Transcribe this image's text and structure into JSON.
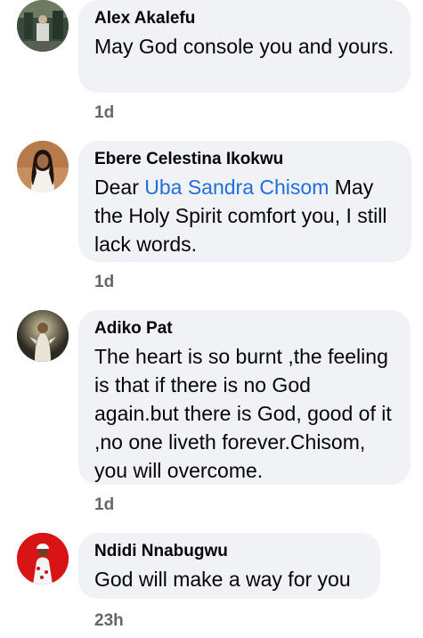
{
  "comments": [
    {
      "author": "Alex Akalefu",
      "text": "May God console you and yours.",
      "time": "1d",
      "avatar_icon": "profile-photo-outdoor-icon"
    },
    {
      "author": "Ebere Celestina Ikokwu",
      "text_before": "Dear ",
      "mention": "Uba Sandra Chisom",
      "text_after": " May the Holy Spirit comfort you, I still lack words.",
      "time": "1d",
      "avatar_icon": "profile-photo-woman-icon"
    },
    {
      "author": "Adiko Pat",
      "text": "The heart is so burnt ,the feeling is that if there is no God again.but there is God, good of it ,no one liveth forever.Chisom, you will overcome.",
      "time": "1d",
      "avatar_icon": "profile-photo-jesus-icon"
    },
    {
      "author": "Ndidi Nnabugwu",
      "text": "God will make a way for you",
      "time": "23h",
      "avatar_icon": "profile-photo-red-dress-icon"
    }
  ],
  "colors": {
    "bubble_bg": "#f0f2f5",
    "mention": "#216fdb",
    "timestamp": "#65676b"
  }
}
